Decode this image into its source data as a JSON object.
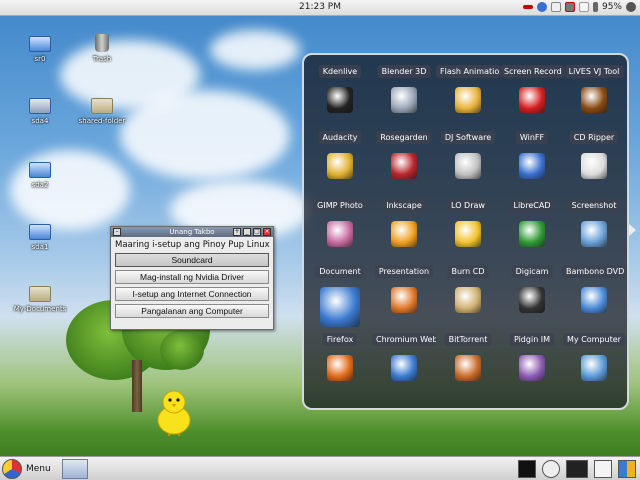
{
  "topbar": {
    "clock": "21:23 PM",
    "battery": "95%"
  },
  "desktop_icons": [
    {
      "id": "sr0",
      "label": "sr0"
    },
    {
      "id": "trash",
      "label": "Trash"
    },
    {
      "id": "sda4",
      "label": "sda4"
    },
    {
      "id": "shared",
      "label": "shared-folder"
    },
    {
      "id": "sda2",
      "label": "sda2"
    },
    {
      "id": "sda1",
      "label": "sda1"
    },
    {
      "id": "mydocs",
      "label": "My-Documents"
    }
  ],
  "dialog": {
    "title": "Unang Takbo",
    "subtitle": "Maaring i-setup ang Pinoy Pup Linux",
    "buttons": [
      "Soundcard",
      "Mag-install ng Nvidia Driver",
      "I-setup ang Internet Connection",
      "Pangalanan ang Computer"
    ]
  },
  "launcher": {
    "apps": [
      {
        "label": "Kdenlive",
        "icon": "film-projector-icon",
        "color": "#222222"
      },
      {
        "label": "Blender 3D",
        "icon": "blender-icon",
        "color": "#9aa6b8"
      },
      {
        "label": "Flash Animatio",
        "icon": "pencil-icon",
        "color": "#e8b23a"
      },
      {
        "label": "Screen Record",
        "icon": "record-icon",
        "color": "#d51f1f"
      },
      {
        "label": "LiVES VJ Tool",
        "icon": "lives-icon",
        "color": "#8a4a12"
      },
      {
        "label": "Audacity",
        "icon": "music-note-icon",
        "color": "#e0b030"
      },
      {
        "label": "Rosegarden",
        "icon": "radio-icon",
        "color": "#b8272b"
      },
      {
        "label": "DJ Software",
        "icon": "dj-mixer-icon",
        "color": "#c0c0c0"
      },
      {
        "label": "WinFF",
        "icon": "convert-icon",
        "color": "#3a6fd0"
      },
      {
        "label": "CD Ripper",
        "icon": "cd-icon",
        "color": "#dcdcdc"
      },
      {
        "label": "GIMP Photo",
        "icon": "brushes-icon",
        "color": "#c86aa0"
      },
      {
        "label": "Inkscape",
        "icon": "inkscape-icon",
        "color": "#f0a020"
      },
      {
        "label": "LO Draw",
        "icon": "lo-draw-icon",
        "color": "#f2c22a"
      },
      {
        "label": "LibreCAD",
        "icon": "librecad-icon",
        "color": "#2f9a34"
      },
      {
        "label": "Screenshot",
        "icon": "monitor-icon",
        "color": "#6aa0d8"
      },
      {
        "label": "Document",
        "icon": "document-icon",
        "color": "#3a7ad0"
      },
      {
        "label": "Presentation",
        "icon": "presentation-icon",
        "color": "#e0782a"
      },
      {
        "label": "Burn CD",
        "icon": "burn-cd-icon",
        "color": "#d0b070"
      },
      {
        "label": "Digicam",
        "icon": "camera-icon",
        "color": "#333333"
      },
      {
        "label": "Bambono DVD",
        "icon": "dvd-icon",
        "color": "#4a8ad8"
      },
      {
        "label": "Firefox",
        "icon": "firefox-icon",
        "color": "#e06a1a"
      },
      {
        "label": "Chromium Web",
        "icon": "chromium-icon",
        "color": "#3a7ad0"
      },
      {
        "label": "BitTorrent",
        "icon": "bittorrent-icon",
        "color": "#c86a2a"
      },
      {
        "label": "Pidgin IM",
        "icon": "pidgin-icon",
        "color": "#8a5ab0"
      },
      {
        "label": "My Computer",
        "icon": "computer-icon",
        "color": "#5a9ad8"
      }
    ]
  },
  "taskbar": {
    "menu_label": "Menu"
  }
}
